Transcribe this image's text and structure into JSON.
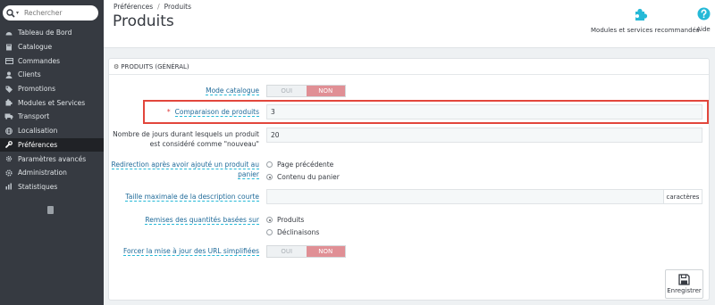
{
  "search": {
    "placeholder": "Rechercher"
  },
  "sidebar": {
    "items": [
      {
        "label": "Tableau de Bord"
      },
      {
        "label": "Catalogue"
      },
      {
        "label": "Commandes"
      },
      {
        "label": "Clients"
      },
      {
        "label": "Promotions"
      },
      {
        "label": "Modules et Services"
      },
      {
        "label": "Transport"
      },
      {
        "label": "Localisation"
      },
      {
        "label": "Préférences"
      },
      {
        "label": "Paramètres avancés"
      },
      {
        "label": "Administration"
      },
      {
        "label": "Statistiques"
      }
    ],
    "active_item": "Préférences"
  },
  "header": {
    "breadcrumb": [
      "Préférences",
      "/",
      "Produits"
    ],
    "title": "Produits",
    "toolbar": {
      "modules_label": "Modules et services recommandés",
      "help_label": "Aide"
    }
  },
  "panel": {
    "heading": "PRODUITS (GÉNÉRAL)",
    "fields": {
      "catalog_mode": {
        "label": "Mode catalogue",
        "off": "OUI",
        "on": "NON",
        "selected": "NON"
      },
      "comparison": {
        "required_mark": "*",
        "label": "Comparaison de produits",
        "value": "3"
      },
      "new_days": {
        "label_line1": "Nombre de jours durant lesquels un produit",
        "label_line2": "est considéré comme \"nouveau\"",
        "value": "20"
      },
      "redirect": {
        "label_line1": "Redirection après avoir ajouté un produit au",
        "label_line2": "panier",
        "options": [
          "Page précédente",
          "Contenu du panier"
        ],
        "selected": "Contenu du panier"
      },
      "short_desc": {
        "label": "Taille maximale de la description courte",
        "value": "",
        "suffix": "caractères"
      },
      "discounts": {
        "label": "Remises des quantités basées sur",
        "options": [
          "Produits",
          "Déclinaisons"
        ],
        "selected": "Produits"
      },
      "friendly_url": {
        "label": "Forcer la mise à jour des URL simplifiées",
        "off": "OUI",
        "on": "NON",
        "selected": "NON"
      }
    },
    "save_label": "Enregistrer"
  },
  "colors": {
    "sidebar_bg": "#363a41",
    "switch_on": "#e08f95",
    "highlight_border": "#e2463c",
    "accent": "#25b9d7"
  }
}
